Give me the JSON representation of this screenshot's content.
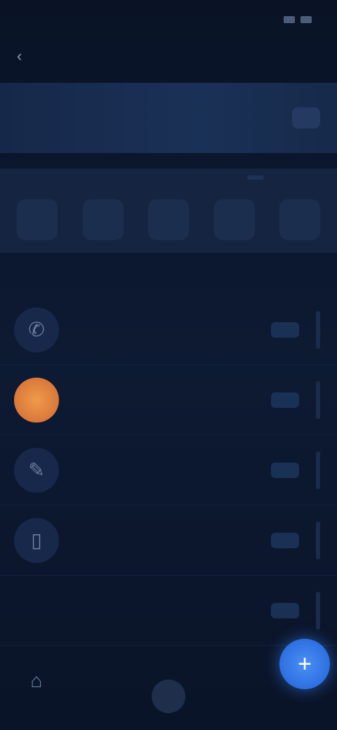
{
  "status_bar": {
    "time": "",
    "battery": ""
  },
  "header": {
    "title": "",
    "back_icon": "arrow-left-icon"
  },
  "top_card": {
    "line1": "",
    "line2": ""
  },
  "week": {
    "label": "",
    "days": [
      {
        "name": "",
        "num": ""
      },
      {
        "name": "",
        "num": ""
      },
      {
        "name": "",
        "num": ""
      },
      {
        "name": "",
        "num": ""
      },
      {
        "name": "",
        "num": ""
      }
    ]
  },
  "tabs": [
    {
      "label": "",
      "active": false
    },
    {
      "label": "",
      "active": true
    },
    {
      "label": "",
      "active": false
    },
    {
      "label": "",
      "active": false
    }
  ],
  "list": [
    {
      "icon": "phone-icon",
      "primary": "",
      "secondary": ""
    },
    {
      "icon": "orange-circle-icon",
      "primary": "",
      "secondary": ""
    },
    {
      "icon": "pencil-icon",
      "primary": "",
      "secondary": ""
    },
    {
      "icon": "device-icon",
      "primary": "",
      "secondary": ""
    },
    {
      "icon": "",
      "primary": "",
      "secondary": ""
    },
    {
      "icon": "home-icon",
      "primary": "",
      "secondary": ""
    }
  ],
  "fab": {
    "icon": "plus-icon"
  },
  "colors": {
    "accent": "#3f86f2",
    "orange": "#e0803d",
    "bg": "#0d1a33"
  }
}
